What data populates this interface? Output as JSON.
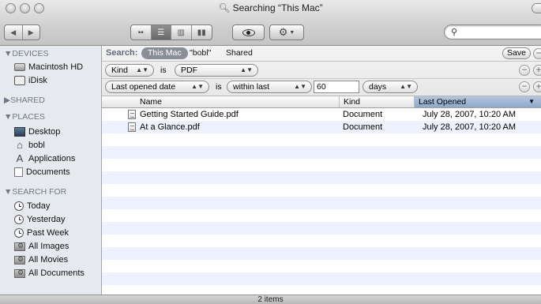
{
  "window": {
    "title": "Searching “This Mac”"
  },
  "toolbar": {
    "back_icon": "◀",
    "forward_icon": "▶",
    "view_icon": "icon-view",
    "view_list": "list-view",
    "view_column": "column-view",
    "view_coverflow": "coverflow-view",
    "quicklook_icon": "eye-icon",
    "action_icon": "gear-icon",
    "search_placeholder": ""
  },
  "sidebar": {
    "devices_header": "▼DEVICES",
    "devices": [
      {
        "label": "Macintosh HD",
        "icon": "hard-drive-icon"
      },
      {
        "label": "iDisk",
        "icon": "idisk-icon"
      }
    ],
    "shared_header": "▶SHARED",
    "places_header": "▼PLACES",
    "places": [
      {
        "label": "Desktop",
        "icon": "desktop-icon"
      },
      {
        "label": "bobl",
        "icon": "home-icon"
      },
      {
        "label": "Applications",
        "icon": "applications-icon"
      },
      {
        "label": "Documents",
        "icon": "documents-icon"
      }
    ],
    "searchfor_header": "▼SEARCH FOR",
    "searches": [
      {
        "label": "Today",
        "icon": "clock-icon"
      },
      {
        "label": "Yesterday",
        "icon": "clock-icon"
      },
      {
        "label": "Past Week",
        "icon": "clock-icon"
      },
      {
        "label": "All Images",
        "icon": "smart-folder-icon"
      },
      {
        "label": "All Movies",
        "icon": "smart-folder-icon"
      },
      {
        "label": "All Documents",
        "icon": "smart-folder-icon"
      }
    ]
  },
  "criteria": {
    "search_label": "Search:",
    "scope_active": "This Mac",
    "scope_user": "\"bobl\"",
    "scope_shared": "Shared",
    "save_label": "Save",
    "row1": {
      "attribute": "Kind",
      "is": "is",
      "value": "PDF"
    },
    "row2": {
      "attribute": "Last opened date",
      "is": "is",
      "operator": "within last",
      "number": "60",
      "unit": "days"
    }
  },
  "list": {
    "columns": {
      "name": "Name",
      "kind": "Kind",
      "last_opened": "Last Opened",
      "sort_indicator": "▼"
    },
    "rows": [
      {
        "name": "Getting Started Guide.pdf",
        "kind": "Document",
        "last_opened": "July 28, 2007, 10:20 AM"
      },
      {
        "name": "At a Glance.pdf",
        "kind": "Document",
        "last_opened": "July 28, 2007, 10:20 AM"
      }
    ]
  },
  "status": {
    "items": "2 items"
  }
}
